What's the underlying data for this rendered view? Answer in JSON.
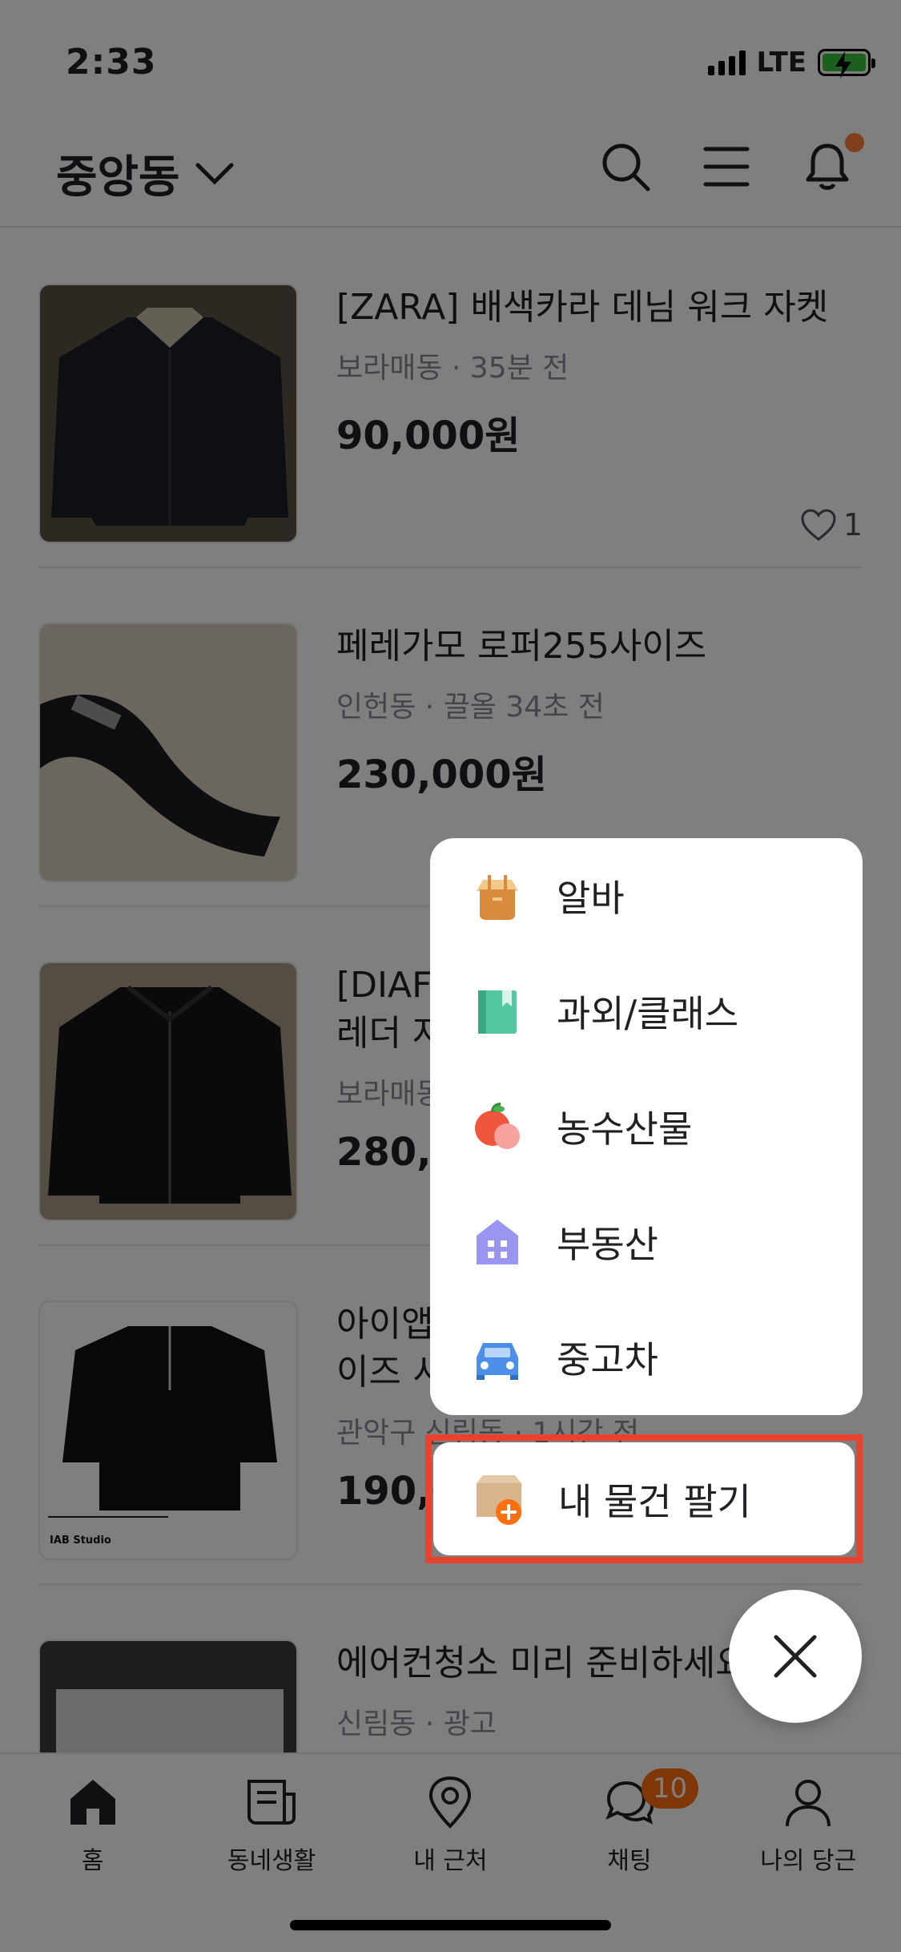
{
  "status_bar": {
    "time": "2:33",
    "network": "LTE"
  },
  "header": {
    "location": "중앙동"
  },
  "products": [
    {
      "title": "[ZARA] 배색카라 데님 워크 자켓",
      "meta": "보라매동 · 35분 전",
      "price": "90,000원",
      "likes": "1"
    },
    {
      "title": "페레가모 로퍼255사이즈",
      "meta": "인헌동 · 끌올 34초 전",
      "price": "230,000원"
    },
    {
      "title": "[DIAF",
      "title2": "레더 자",
      "meta": "보라매동",
      "price": "280,0"
    },
    {
      "title": "아이앱",
      "title2": "이즈 서",
      "meta": "관악구 신림동 · 1시간 전",
      "price": "190,0",
      "thumb_text": "IAB Studio"
    },
    {
      "title": "에어컨청소 미리 준비하세요",
      "meta": "신림동 · 광고"
    }
  ],
  "popup_menu": {
    "items": [
      {
        "label": "알바",
        "icon": "part-time-job-icon"
      },
      {
        "label": "과외/클래스",
        "icon": "book-icon"
      },
      {
        "label": "농수산물",
        "icon": "apple-icon"
      },
      {
        "label": "부동산",
        "icon": "house-icon"
      },
      {
        "label": "중고차",
        "icon": "car-icon"
      }
    ],
    "sell_button": "내 물건 팔기"
  },
  "tabs": [
    {
      "label": "홈",
      "icon": "home-icon"
    },
    {
      "label": "동네생활",
      "icon": "newspaper-icon"
    },
    {
      "label": "내 근처",
      "icon": "location-pin-icon"
    },
    {
      "label": "채팅",
      "icon": "chat-icon",
      "badge": "10"
    },
    {
      "label": "나의 당근",
      "icon": "person-icon"
    }
  ],
  "colors": {
    "accent": "#ff6f0f",
    "highlight_border": "#e8432f"
  }
}
